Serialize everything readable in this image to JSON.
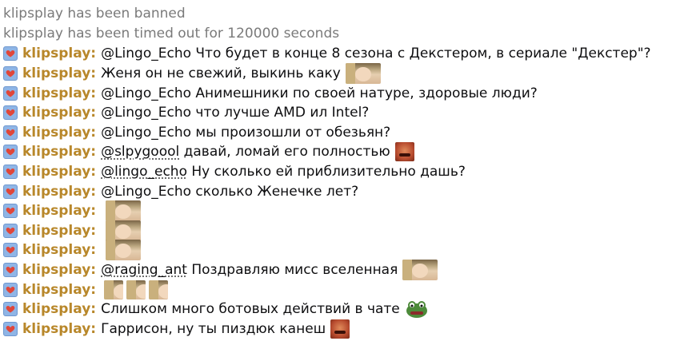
{
  "system_messages": [
    "klipsplay has been banned",
    "klipsplay has been timed out for 120000 seconds"
  ],
  "username": "klipsplay:",
  "badge_icon": "heart-badge-icon",
  "colors": {
    "username": "#b8872a",
    "system": "#7a7a7a",
    "badge": "#8fb5e6",
    "heart": "#e0463a"
  },
  "messages": [
    {
      "mention": "",
      "text": "@Lingo_Echo Что будет в конце 8 сезона с Декстером, в сериале \"Декстер\"?",
      "emotes": []
    },
    {
      "mention": "",
      "text": "Женя он не свежий, выкинь каку",
      "emotes": [
        "face-emote"
      ]
    },
    {
      "mention": "",
      "text": "@Lingo_Echo Анимешники по своей натуре, здоровые люди?",
      "emotes": []
    },
    {
      "mention": "",
      "text": "@Lingo_Echo что лучше AMD ил Intel?",
      "emotes": []
    },
    {
      "mention": "",
      "text": "@Lingo_Echo мы произошли от обезьян?",
      "emotes": []
    },
    {
      "mention": "@slpygoool",
      "text": " давай, ломай его полностью",
      "emotes": [
        "red-face-emote"
      ]
    },
    {
      "mention": "@lingo_echo",
      "text": " Ну сколько ей приблизительно дашь?",
      "emotes": []
    },
    {
      "mention": "",
      "text": "@Lingo_Echo сколько Женечке лет?",
      "emotes": []
    },
    {
      "mention": "",
      "text": "",
      "emotes": [
        "face-emote"
      ]
    },
    {
      "mention": "",
      "text": "",
      "emotes": [
        "face-emote"
      ]
    },
    {
      "mention": "",
      "text": "",
      "emotes": [
        "face-emote"
      ]
    },
    {
      "mention": "@raging_ant",
      "text": " Поздравляю мисс вселенная",
      "emotes": [
        "face-emote"
      ]
    },
    {
      "mention": "",
      "text": "",
      "emotes": [
        "small-face-emote",
        "small-face-emote",
        "small-face-emote"
      ]
    },
    {
      "mention": "",
      "text": "Слишком много ботовых действий в чате",
      "emotes": [
        "frog-emote"
      ]
    },
    {
      "mention": "",
      "text": "Гаррисон, ну ты пиздюк канеш",
      "emotes": [
        "red-face-emote"
      ]
    }
  ]
}
